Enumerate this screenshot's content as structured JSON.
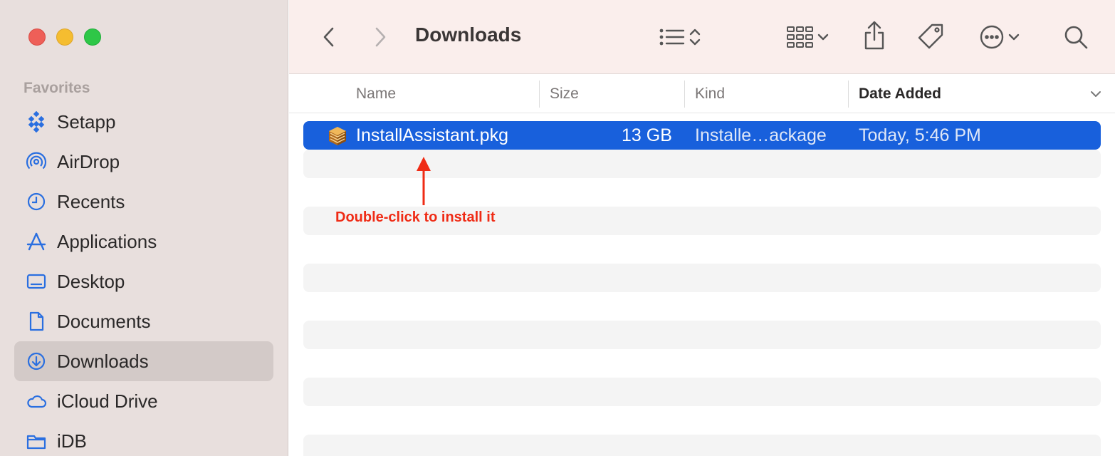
{
  "window": {
    "title": "Downloads"
  },
  "sidebar": {
    "section_label": "Favorites",
    "items": [
      {
        "label": "Setapp",
        "icon": "setapp-icon"
      },
      {
        "label": "AirDrop",
        "icon": "airdrop-icon"
      },
      {
        "label": "Recents",
        "icon": "clock-icon"
      },
      {
        "label": "Applications",
        "icon": "applications-icon"
      },
      {
        "label": "Desktop",
        "icon": "desktop-icon"
      },
      {
        "label": "Documents",
        "icon": "document-icon"
      },
      {
        "label": "Downloads",
        "icon": "download-icon",
        "active": true
      },
      {
        "label": "iCloud Drive",
        "icon": "cloud-icon"
      },
      {
        "label": "iDB",
        "icon": "folder-icon"
      }
    ]
  },
  "columns": {
    "name": "Name",
    "size": "Size",
    "kind": "Kind",
    "date_added": "Date Added"
  },
  "files": [
    {
      "name": "InstallAssistant.pkg",
      "size": "13 GB",
      "kind": "Installe…ackage",
      "date_added": "Today, 5:46 PM",
      "selected": true
    }
  ],
  "annotation": {
    "text": "Double-click to install it"
  },
  "colors": {
    "accent": "#1860dc",
    "annotation": "#ef2b15",
    "sidebar_bg": "#e8dfdd",
    "toolbar_bg": "#faeeec"
  }
}
